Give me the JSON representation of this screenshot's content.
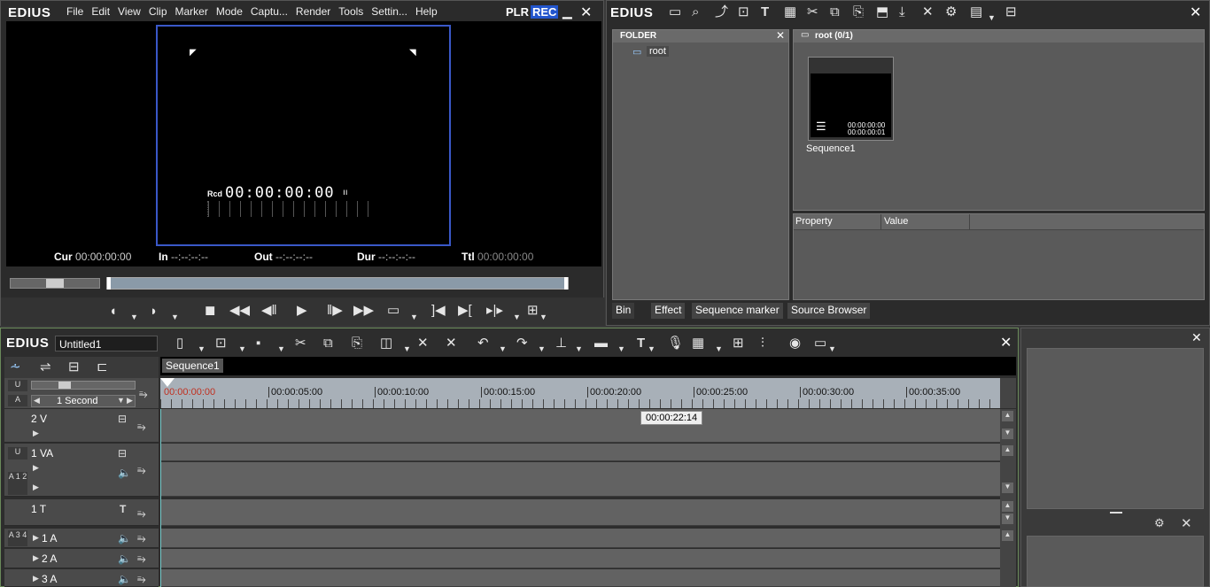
{
  "player": {
    "logo": "EDIUS",
    "menu": [
      "File",
      "Edit",
      "View",
      "Clip",
      "Marker",
      "Mode",
      "Captu...",
      "Render",
      "Tools",
      "Settin...",
      "Help"
    ],
    "plr_label": "PLR",
    "rec_label": "REC",
    "rcd_label": "Rcd",
    "timecode": "00:00:00:00",
    "cur_label": "Cur",
    "cur_value": "00:00:00:00",
    "in_label": "In",
    "in_value": "--:--:--:--",
    "out_label": "Out",
    "out_value": "--:--:--:--",
    "dur_label": "Dur",
    "dur_value": "--:--:--:--",
    "ttl_label": "Ttl",
    "ttl_value": "00:00:00:00"
  },
  "bin": {
    "logo": "EDIUS",
    "folder_header": "FOLDER",
    "root_item": "root",
    "root_path": "root (0/1)",
    "clip_name": "Sequence1",
    "clip_tc_in": "00:00:00:00",
    "clip_tc_dur": "00:00:00:01",
    "property_col": "Property",
    "value_col": "Value",
    "tabs": [
      "Bin",
      "Effect",
      "Sequence marker",
      "Source Browser"
    ]
  },
  "timeline": {
    "logo": "EDIUS",
    "project_name": "Untitled1",
    "sequence_tab": "Sequence1",
    "scale": "1 Second",
    "ruler": [
      "00:00:00:00",
      "00:00:05:00",
      "00:00:10:00",
      "00:00:15:00",
      "00:00:20:00",
      "00:00:25:00",
      "00:00:30:00",
      "00:00:35:00"
    ],
    "tooltip": "00:00:22:14",
    "tracks": [
      "2 V",
      "1 VA",
      "1 T",
      "1 A",
      "2 A",
      "3 A"
    ],
    "a12_label": "A 1 2",
    "a34_label": "A 3 4"
  },
  "colors": {
    "accent": "#2255cc",
    "border_green": "#6a8a5a"
  }
}
